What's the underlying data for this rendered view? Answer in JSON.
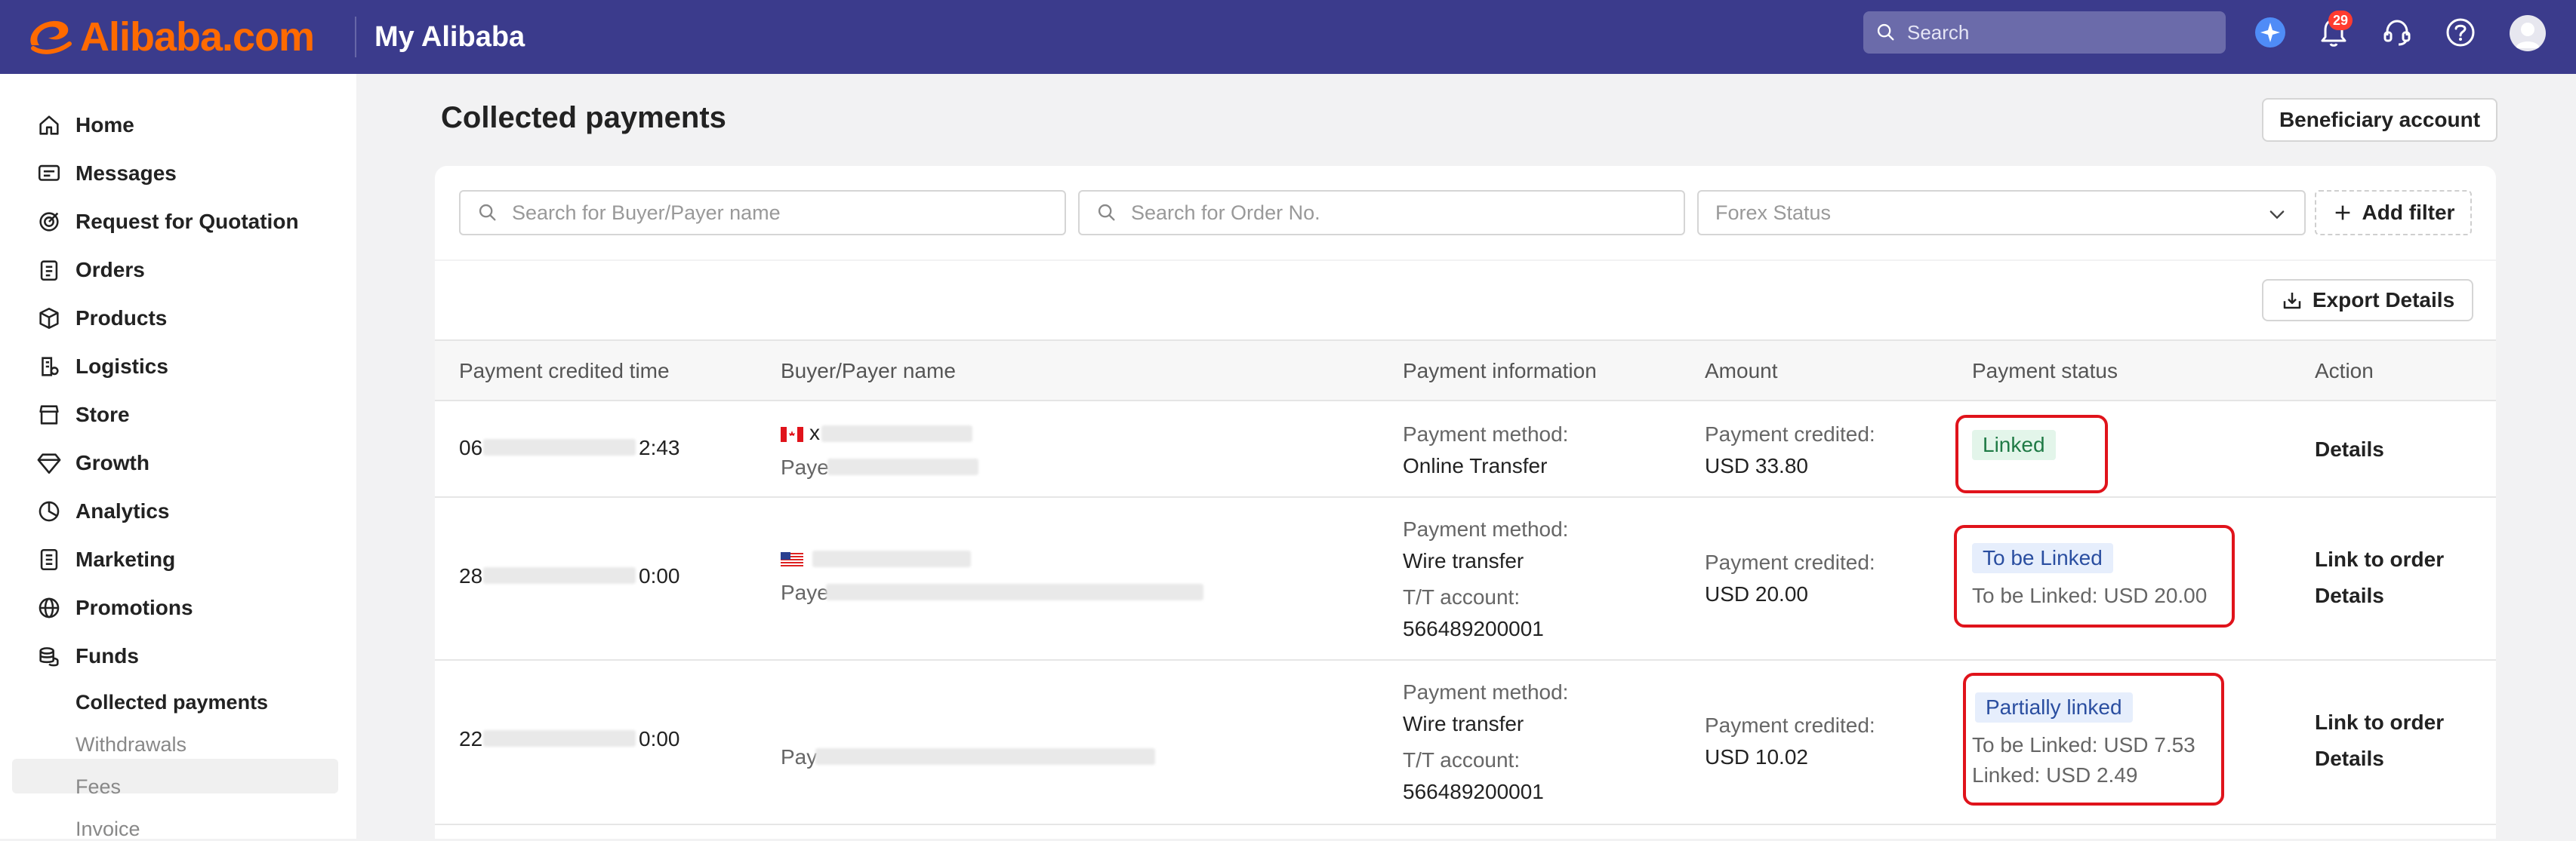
{
  "topbar": {
    "brand": "Alibaba.com",
    "app_title": "My Alibaba",
    "search_placeholder": "Search",
    "notification_count": "29",
    "colors": {
      "bar": "#3b3b8c",
      "brand": "#ff6a00"
    },
    "icons": [
      "search-icon",
      "ai-sparkle-icon",
      "bell-icon",
      "headset-icon",
      "help-icon",
      "avatar"
    ]
  },
  "sidebar": {
    "items": [
      {
        "label": "Home",
        "icon": "home-icon"
      },
      {
        "label": "Messages",
        "icon": "message-icon"
      },
      {
        "label": "Request for Quotation",
        "icon": "target-icon"
      },
      {
        "label": "Orders",
        "icon": "clipboard-icon"
      },
      {
        "label": "Products",
        "icon": "box-icon"
      },
      {
        "label": "Logistics",
        "icon": "truck-icon"
      },
      {
        "label": "Store",
        "icon": "store-icon"
      },
      {
        "label": "Growth",
        "icon": "diamond-icon"
      },
      {
        "label": "Analytics",
        "icon": "pie-chart-icon"
      },
      {
        "label": "Marketing",
        "icon": "document-icon"
      },
      {
        "label": "Promotions",
        "icon": "globe-icon"
      },
      {
        "label": "Funds",
        "icon": "coins-icon"
      }
    ],
    "funds_sub": [
      "Collected payments",
      "Withdrawals",
      "Fees",
      "Invoice"
    ]
  },
  "main": {
    "title": "Collected payments",
    "beneficiary_button": "Beneficiary account",
    "filters": {
      "buyer_placeholder": "Search for Buyer/Payer name",
      "order_placeholder": "Search for Order No.",
      "forex_status": "Forex Status",
      "add_filter": "Add filter"
    },
    "export_button": "Export Details",
    "columns": [
      "Payment credited time",
      "Buyer/Payer name",
      "Payment information",
      "Amount",
      "Payment status",
      "Action"
    ],
    "rows": [
      {
        "time_start": "06",
        "time_end": "2:43",
        "buyer_start": "x",
        "payer_prefix": "Paye",
        "method_label": "Payment method:",
        "method": "Online Transfer",
        "amount_label": "Payment credited:",
        "amount": "USD 33.80",
        "status": "Linked",
        "actions": [
          "Details"
        ]
      },
      {
        "time_start": "28",
        "time_end": "0:00",
        "payer_prefix": "Paye",
        "method_label": "Payment method:",
        "method": "Wire transfer",
        "tt_label": "T/T account:",
        "tt_account": "566489200001",
        "amount_label": "Payment credited:",
        "amount": "USD 20.00",
        "status": "To be Linked",
        "status_detail": "To be Linked: USD 20.00",
        "actions": [
          "Link to order",
          "Details"
        ]
      },
      {
        "time_start": "22",
        "time_end": "0:00",
        "payer_prefix": "Pay",
        "method_label": "Payment method:",
        "method": "Wire transfer",
        "tt_label": "T/T account:",
        "tt_account": "566489200001",
        "amount_label": "Payment credited:",
        "amount": "USD 10.02",
        "status": "Partially linked",
        "status_detail": "To be Linked: USD 7.53",
        "status_detail2": "Linked: USD 2.49",
        "actions": [
          "Link to order",
          "Details"
        ]
      }
    ]
  }
}
